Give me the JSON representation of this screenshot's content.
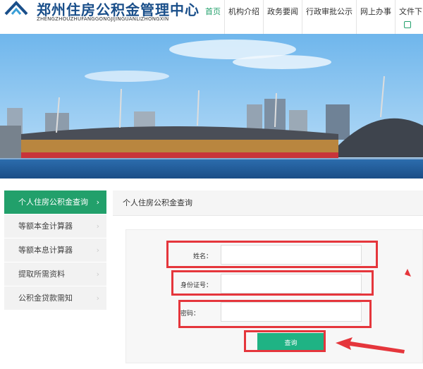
{
  "header": {
    "title": "郑州住房公积金管理中心",
    "subtitle": "ZHENGZHOUZHUFANGGONGJIJINGUANLIZHONGXIN",
    "nav": [
      {
        "label": "首页",
        "active": true
      },
      {
        "label": "机构介绍",
        "active": false
      },
      {
        "label": "政务要闻",
        "active": false
      },
      {
        "label": "行政审批公示",
        "active": false
      },
      {
        "label": "网上办事",
        "active": false
      },
      {
        "label": "文件下",
        "active": false
      }
    ]
  },
  "sidebar": {
    "items": [
      {
        "label": "个人住房公积金查询",
        "active": true
      },
      {
        "label": "等额本金计算器",
        "active": false
      },
      {
        "label": "等额本息计算器",
        "active": false
      },
      {
        "label": "提取所需资料",
        "active": false
      },
      {
        "label": "公积金贷款需知",
        "active": false
      }
    ]
  },
  "main": {
    "title": "个人住房公积金查询",
    "form": {
      "name_label": "姓名：",
      "id_label": "身份证号：",
      "password_label": "密码：",
      "name_value": "",
      "id_value": "",
      "password_value": "",
      "submit_label": "查询"
    }
  },
  "colors": {
    "accent": "#22a06b",
    "button": "#1fb384",
    "annotation": "#e5363c",
    "brand": "#1a4f8a"
  }
}
